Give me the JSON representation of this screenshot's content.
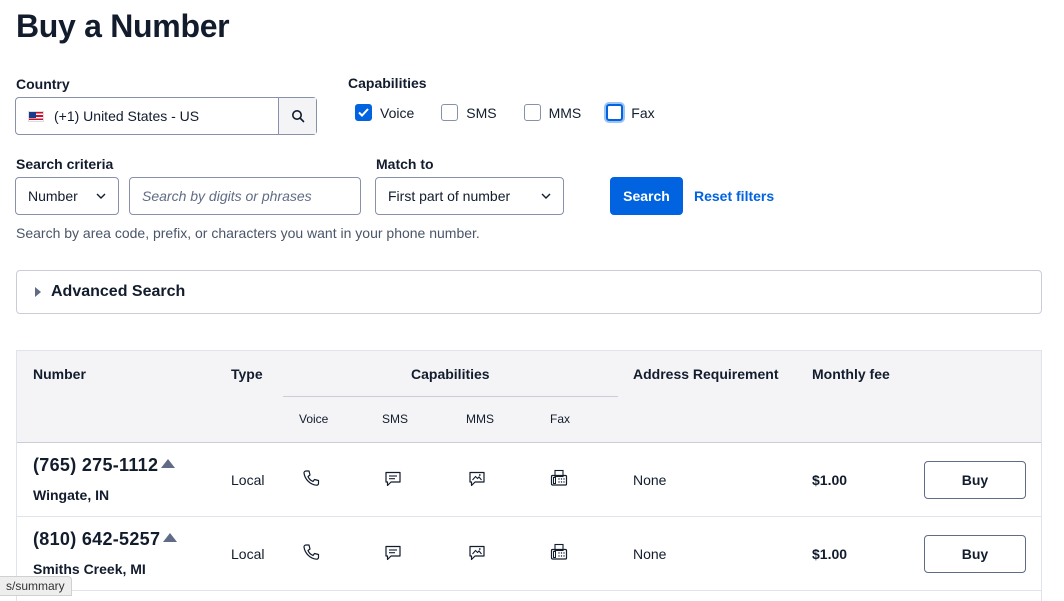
{
  "page": {
    "title": "Buy a Number"
  },
  "country": {
    "label": "Country",
    "value": "(+1) United States - US",
    "flag_icon": "us-flag-icon"
  },
  "capabilities": {
    "label": "Capabilities",
    "options": [
      {
        "label": "Voice",
        "checked": true
      },
      {
        "label": "SMS",
        "checked": false
      },
      {
        "label": "MMS",
        "checked": false
      },
      {
        "label": "Fax",
        "checked": false
      }
    ]
  },
  "search_criteria": {
    "label": "Search criteria",
    "value": "Number",
    "placeholder": "Search by digits or phrases"
  },
  "match_to": {
    "label": "Match to",
    "value": "First part of number"
  },
  "search_button": "Search",
  "reset_link": "Reset filters",
  "helper_text": "Search by area code, prefix, or characters you want in your phone number.",
  "advanced_search": "Advanced Search",
  "table": {
    "headers": {
      "number": "Number",
      "type": "Type",
      "capabilities": "Capabilities",
      "voice": "Voice",
      "sms": "SMS",
      "mms": "MMS",
      "fax": "Fax",
      "address": "Address Requirement",
      "fee": "Monthly fee"
    },
    "rows": [
      {
        "number": "(765) 275-1112",
        "location": "Wingate, IN",
        "type": "Local",
        "address": "None",
        "fee": "$1.00",
        "buy": "Buy"
      },
      {
        "number": "(810) 642-5257",
        "location": "Smiths Creek, MI",
        "type": "Local",
        "address": "None",
        "fee": "$1.00",
        "buy": "Buy"
      }
    ]
  },
  "status_bar_url": "s/summary",
  "colors": {
    "primary": "#0263e0",
    "text": "#121c2d",
    "header_bg": "#f4f4f6"
  }
}
